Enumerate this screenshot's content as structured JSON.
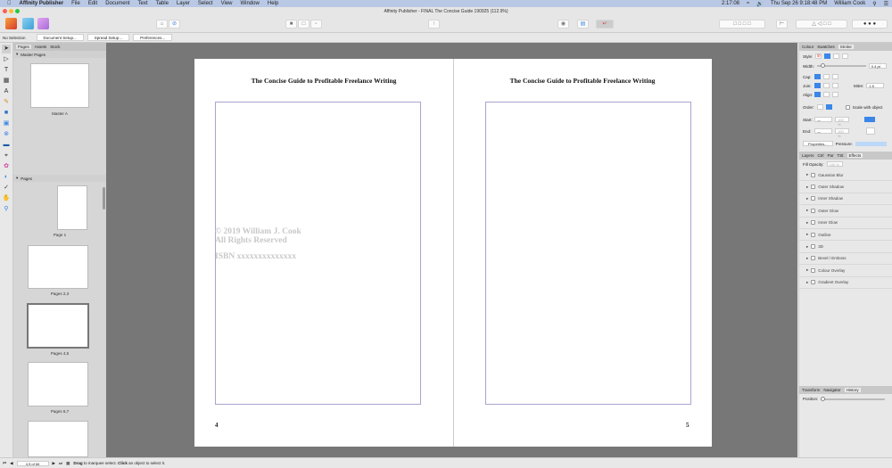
{
  "menubar": {
    "app": "Affinity Publisher",
    "items": [
      "File",
      "Edit",
      "Document",
      "Text",
      "Table",
      "Layer",
      "Select",
      "View",
      "Window",
      "Help"
    ],
    "battery": "2:17:08",
    "datetime": "Thu Sep 26  9:18:48 PM",
    "user": "William Cook"
  },
  "window": {
    "title": "Affinity Publisher - FINAL The Concise Guide 190925 (112.9%)"
  },
  "context": {
    "selection": "No Selection",
    "buttons": [
      "Document Setup...",
      "Spread Setup...",
      "Preferences..."
    ]
  },
  "pages_panel": {
    "tabs": [
      "Pages",
      "Assets",
      "Stock"
    ],
    "master_header": "Master Pages",
    "master_label": "Master A",
    "pages_header": "Pages",
    "thumbs": [
      "Page 1",
      "Pages 2,3",
      "Pages 4,5",
      "Pages 6,7"
    ]
  },
  "spread": {
    "title_left": "The Concise Guide to Profitable Freelance Writing",
    "title_right": "The Concise Guide to Profitable Freelance Writing",
    "copyright": "© 2019 William J. Cook",
    "rights": "All Rights Reserved",
    "isbn": "ISBN xxxxxxxxxxxxxx",
    "page_left": "4",
    "page_right": "5"
  },
  "right_panel": {
    "tabs1": [
      "Colour",
      "Swatches",
      "Stroke"
    ],
    "style_label": "Style:",
    "width_label": "Width:",
    "width_value": "0.4 pt",
    "cap_label": "Cap:",
    "join_label": "Join:",
    "mitre_label": "Mitre:",
    "mitre_value": "1.5",
    "align_label": "Align:",
    "order_label": "Order:",
    "scale_label": "Scale with object",
    "start_label": "Start:",
    "end_label": "End:",
    "arrow_pct": "100 %",
    "properties": "Properties...",
    "pressure": "Pressure:",
    "tabs2": [
      "Layers",
      "Ctrl",
      "Par",
      "TSt",
      "Effects"
    ],
    "fill_opacity_label": "Fill Opacity:",
    "fill_opacity": "100 %",
    "effects": [
      "Gaussian Blur",
      "Outer Shadow",
      "Inner Shadow",
      "Outer Glow",
      "Inner Glow",
      "Outline",
      "3D",
      "Bevel / Emboss",
      "Colour Overlay",
      "Gradient Overlay"
    ],
    "tabs3": [
      "Transform",
      "Navigator",
      "History"
    ],
    "position_label": "Position:"
  },
  "status": {
    "page": "4,5 of 66",
    "hint_bold1": "Drag",
    "hint1": " to marquee select. ",
    "hint_bold2": "Click",
    "hint2": " an object to select it."
  }
}
